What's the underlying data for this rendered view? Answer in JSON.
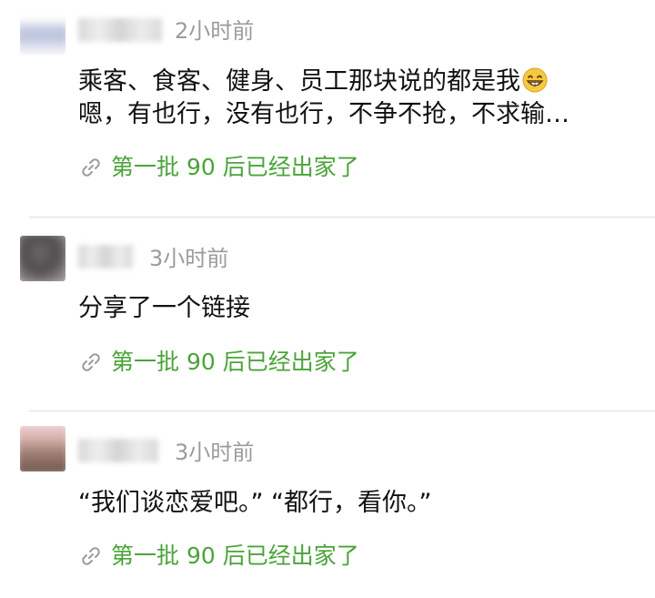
{
  "posts": [
    {
      "timestamp": "2小时前",
      "content_line1": "乘客、食客、健身、员工那块说的都是我",
      "content_emoji": "grinning-face-emoji",
      "content_line2": "嗯，有也行，没有也行，不争不抢，不求输…",
      "link_title": "第一批 90 后已经出家了"
    },
    {
      "timestamp": "3小时前",
      "content_line1": "分享了一个链接",
      "link_title": "第一批 90 后已经出家了"
    },
    {
      "timestamp": "3小时前",
      "content_line1": "“我们谈恋爱吧。” “都行，看你。”",
      "link_title": "第一批 90 后已经出家了"
    }
  ],
  "icons": {
    "link": "link-icon",
    "avatar": "avatar"
  },
  "colors": {
    "link_green": "#4aa43a",
    "timestamp_gray": "#9b9b9b",
    "divider": "#dddddd"
  }
}
